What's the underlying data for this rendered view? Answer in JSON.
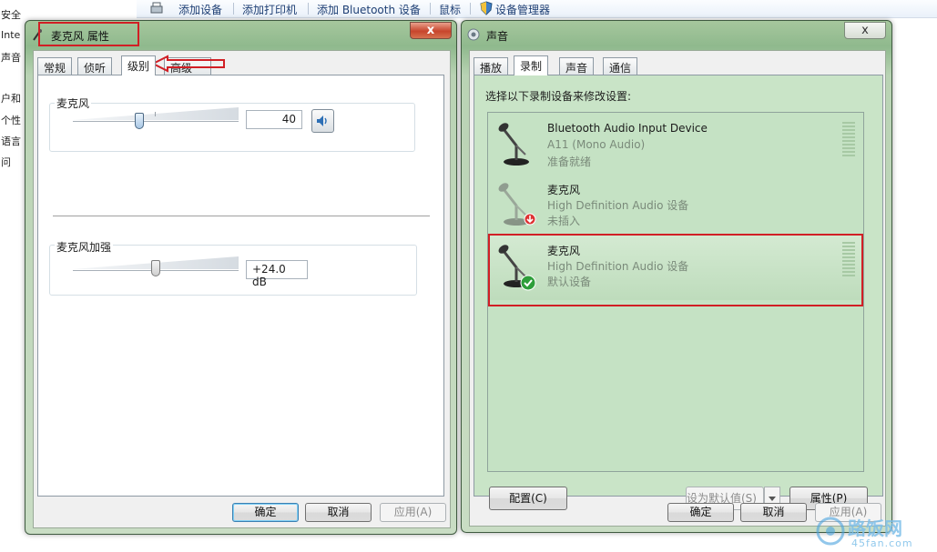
{
  "background": {
    "left_panel_items": [
      "安全",
      "Inte",
      "声音",
      "户和",
      "个性",
      "语言",
      "问"
    ],
    "toolbar_items": [
      "添加设备",
      "添加打印机",
      "添加 Bluetooth 设备",
      "鼠标",
      "设备管理器"
    ]
  },
  "mic_props": {
    "title": "麦克风 属性",
    "close_glyph": "x",
    "tabs": [
      "常规",
      "侦听",
      "级别",
      "高级"
    ],
    "active_tab": "级别",
    "level_group_label": "麦克风",
    "level_value": "40",
    "level_fraction": 0.4,
    "boost_group_label": "麦克风加强",
    "boost_value": "+24.0 dB",
    "boost_fraction": 0.5,
    "buttons": {
      "ok": "确定",
      "cancel": "取消",
      "apply": "应用(A)"
    }
  },
  "sound": {
    "title": "声音",
    "close_glyph": "x",
    "tabs": [
      "播放",
      "录制",
      "声音",
      "通信"
    ],
    "active_tab": "录制",
    "instruction": "选择以下录制设备来修改设置:",
    "devices": [
      {
        "name": "Bluetooth Audio Input Device",
        "line2": "A11 (Mono Audio)",
        "status": "准备就绪"
      },
      {
        "name": "麦克风",
        "line2": "High Definition Audio 设备",
        "status": "未插入"
      },
      {
        "name": "麦克风",
        "line2": "High Definition Audio 设备",
        "status": "默认设备"
      }
    ],
    "buttons": {
      "configure": "配置(C)",
      "set_default": "设为默认值(S)",
      "properties": "属性(P)",
      "ok": "确定",
      "cancel": "取消",
      "apply": "应用(A)"
    }
  },
  "watermark": {
    "brand": "路饭网",
    "site": "45fan.com"
  },
  "colors": {
    "highlight_red": "#d11f25",
    "window_green": "#a6c79d",
    "list_green": "#c5e2c4"
  }
}
